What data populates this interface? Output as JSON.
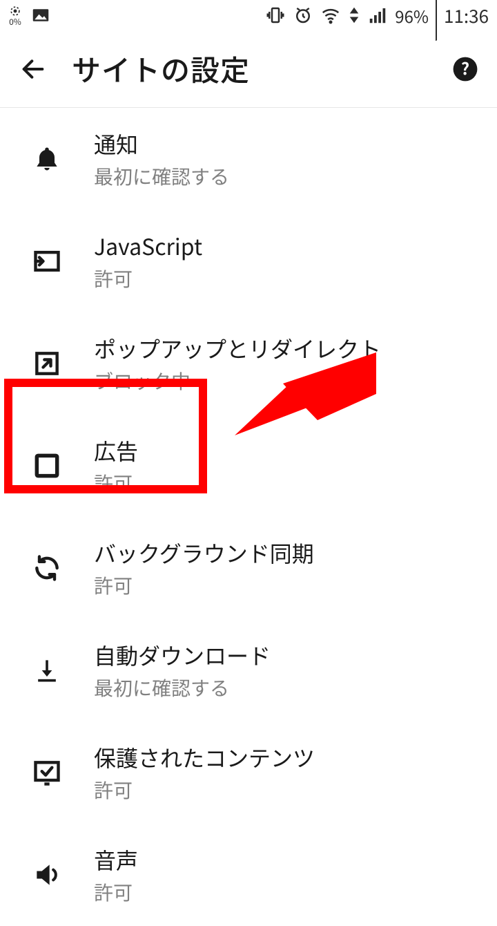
{
  "status": {
    "data_pct": "0%",
    "battery_pct": "96%",
    "time": "11:36"
  },
  "appbar": {
    "title": "サイトの設定"
  },
  "rows": [
    {
      "icon": "bell",
      "label": "通知",
      "sub": "最初に確認する"
    },
    {
      "icon": "js",
      "label": "JavaScript",
      "sub": "許可"
    },
    {
      "icon": "popup",
      "label": "ポップアップとリダイレクト",
      "sub": "ブロック中"
    },
    {
      "icon": "ads",
      "label": "広告",
      "sub": "許可"
    },
    {
      "icon": "sync",
      "label": "バックグラウンド同期",
      "sub": "許可"
    },
    {
      "icon": "download",
      "label": "自動ダウンロード",
      "sub": "最初に確認する"
    },
    {
      "icon": "protected",
      "label": "保護されたコンテンツ",
      "sub": "許可"
    },
    {
      "icon": "sound",
      "label": "音声",
      "sub": "許可"
    }
  ],
  "annotation": {
    "color": "#ff0000"
  }
}
